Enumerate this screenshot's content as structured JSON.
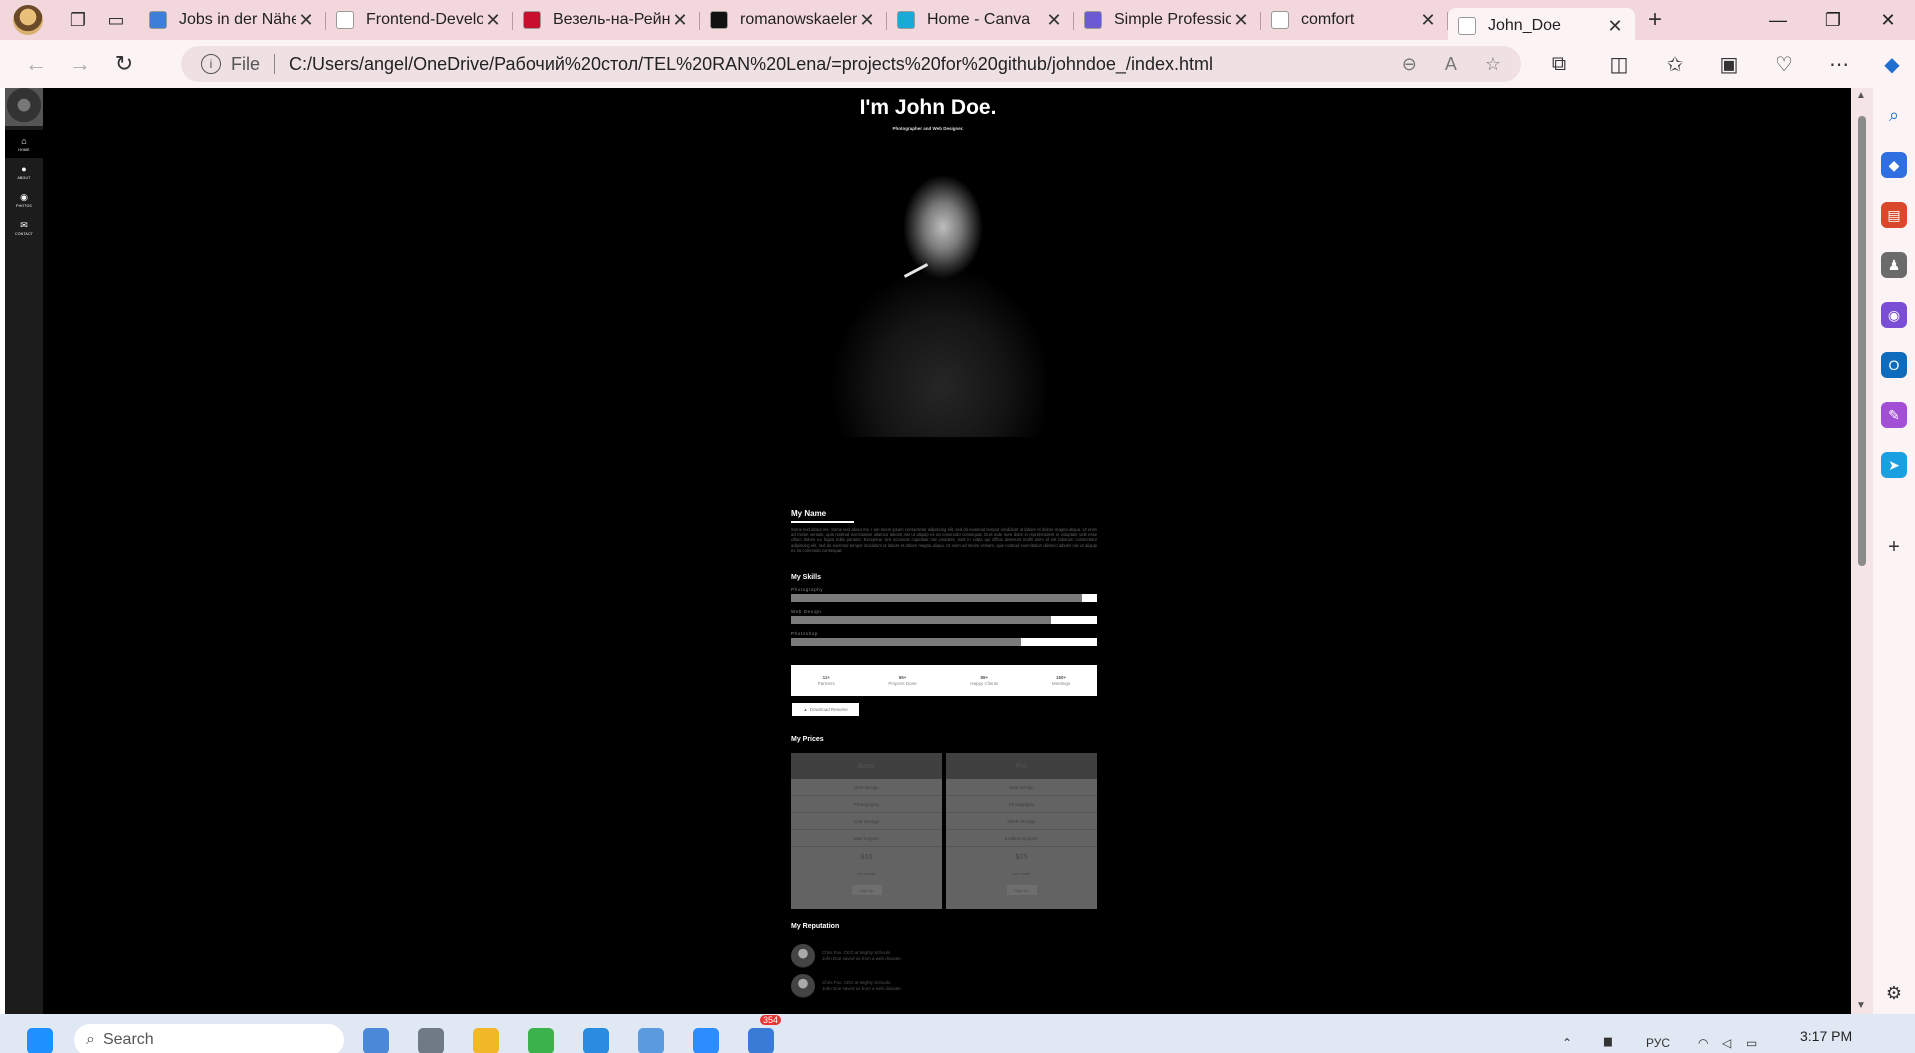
{
  "browser": {
    "tabs": [
      {
        "title": "Jobs in der Nähe",
        "icon": "j-icon",
        "color": "#3b7fd6"
      },
      {
        "title": "Frontend-Developer",
        "icon": "it-icon",
        "color": "#ffffff"
      },
      {
        "title": "Везель-на-Рейне",
        "icon": "z-icon",
        "color": "#c8102e"
      },
      {
        "title": "romanowskaelena",
        "icon": "github-icon",
        "color": "#111111"
      },
      {
        "title": "Home - Canva",
        "icon": "canva-icon",
        "color": "#1aa9d8"
      },
      {
        "title": "Simple Professional",
        "icon": "site-icon",
        "color": "#6b5bd2"
      },
      {
        "title": "comfort",
        "icon": "page-icon",
        "color": "#ffffff"
      },
      {
        "title": "John_Doe",
        "icon": "page-icon",
        "color": "#ffffff"
      }
    ],
    "active_tab": 7,
    "address": {
      "scheme_label": "File",
      "url": "C:/Users/angel/OneDrive/Рабочий%20стол/TEL%20RAN%20Lena/=projects%20for%20github/johndoe_/index.html"
    }
  },
  "site": {
    "title": "I'm John Doe.",
    "subtitle": "Photographer and Web Designer.",
    "nav": [
      {
        "label": "Home",
        "icon": "home-icon"
      },
      {
        "label": "About",
        "icon": "user-icon"
      },
      {
        "label": "Photos",
        "icon": "eye-icon"
      },
      {
        "label": "Contact",
        "icon": "envelope-icon"
      }
    ],
    "about_heading": "My Name",
    "about_text": "Some text about me. Some text about me. I am lorem ipsum consectetur adipiscing elit, sed do eiusmod tempor incididunt ut labore et dolore magna aliqua. Ut enim ad minim veniam, quis nostrud exercitation ullamco laboris nisi ut aliquip ex ea commodo consequat. Duis aute irure dolor in reprehenderit in voluptate velit esse cillum dolore eu fugiat nulla pariatur. Excepteur sint occaecat cupidatat non proident, sunt in culpa qui officia deserunt mollit anim id est laborum consectetur adipiscing elit, sed do eiusmod tempor incididunt ut labore et dolore magna aliqua. Ut enim ad minim veniam, quis nostrud exercitation ullamco laboris nisi ut aliquip ex ea commodo consequat.",
    "skills_heading": "My Skills",
    "skills": [
      {
        "label": "Photography",
        "percent": 95
      },
      {
        "label": "Web Design",
        "percent": 85
      },
      {
        "label": "Photoshop",
        "percent": 75
      }
    ],
    "stats": [
      {
        "value": "11+",
        "label": "Partners"
      },
      {
        "value": "55+",
        "label": "Projects Done"
      },
      {
        "value": "89+",
        "label": "Happy Clients"
      },
      {
        "value": "150+",
        "label": "Meetings"
      }
    ],
    "download_label": "Download Resume",
    "prices_heading": "My Prices",
    "plans": [
      {
        "name": "Basic",
        "features": [
          "Web Design",
          "Photography",
          "1GB Storage",
          "Mail Support"
        ],
        "price": "$10",
        "period": "per month",
        "cta": "Sign Up"
      },
      {
        "name": "Pro",
        "features": [
          "Web Design",
          "Photography",
          "50GB Storage",
          "Endless Support"
        ],
        "price": "$25",
        "period": "per month",
        "cta": "Sign Up"
      }
    ],
    "reputation_heading": "My Reputation",
    "testimonials": [
      {
        "author": "Chris Fox. CEO at Mighty Schools.",
        "quote": "John Doe saved us from a web disaster."
      },
      {
        "author": "Chris Fox. CEO at Mighty Schools.",
        "quote": "John Doe saved us from a web disaster."
      }
    ]
  },
  "taskbar": {
    "search_placeholder": "Search",
    "language": "РУС",
    "time": "3:17 PM",
    "badge": "354"
  }
}
